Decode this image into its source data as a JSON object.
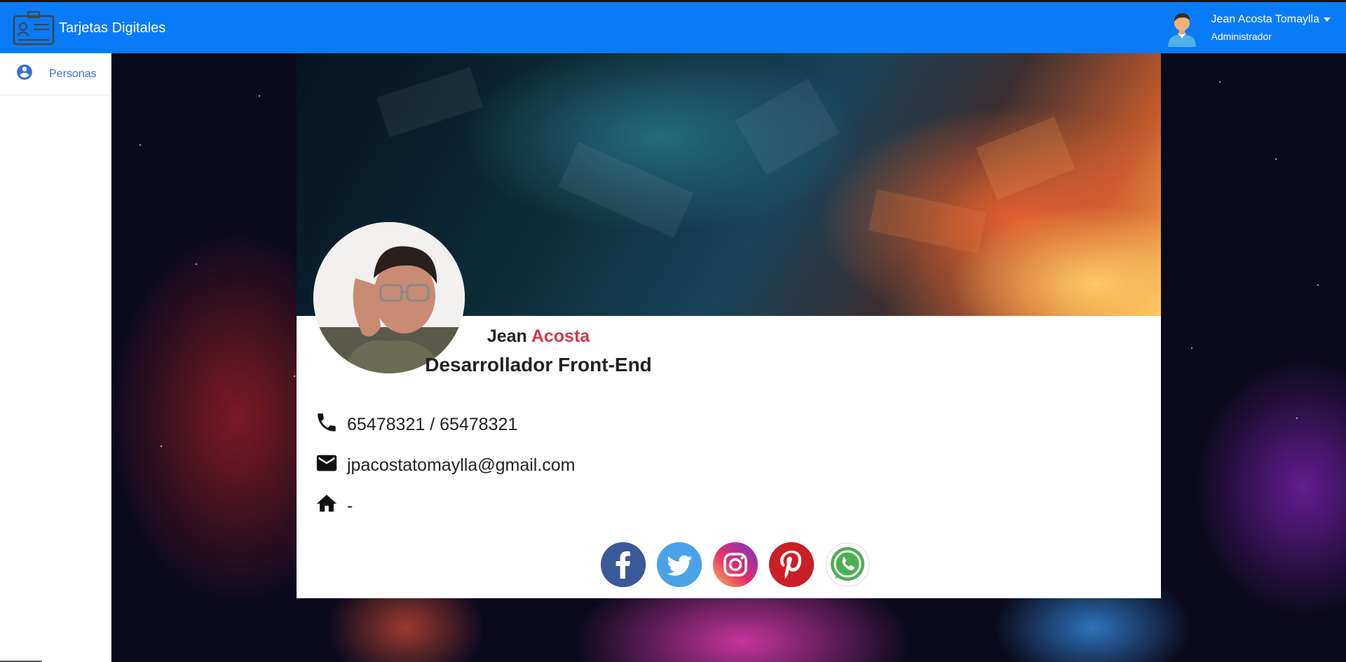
{
  "app": {
    "title": "Tarjetas Digitales",
    "accent_color": "#0a7bf7",
    "logo_icon": "id-card-icon"
  },
  "user": {
    "name": "Jean Acosta Tomaylla",
    "role": "Administrador",
    "avatar_icon": "user-avatar-icon"
  },
  "sidebar": {
    "items": [
      {
        "label": "Personas",
        "icon": "account-circle-icon"
      }
    ]
  },
  "card": {
    "first_name": "Jean",
    "last_name": "Acosta",
    "last_name_color": "#d9364a",
    "title": "Desarrollador Front-End",
    "phone": "65478321 / 65478321",
    "email": "jpacostatomaylla@gmail.com",
    "address": "-",
    "contacts_icons": [
      "phone-icon",
      "email-icon",
      "home-icon"
    ],
    "socials": [
      {
        "name": "facebook",
        "icon": "facebook-icon",
        "color": "#3b5998"
      },
      {
        "name": "twitter",
        "icon": "twitter-icon",
        "color": "#4aa3e8"
      },
      {
        "name": "instagram",
        "icon": "instagram-icon",
        "color": "#c32aa3"
      },
      {
        "name": "pinterest",
        "icon": "pinterest-icon",
        "color": "#cb1f27"
      },
      {
        "name": "whatsapp",
        "icon": "whatsapp-icon",
        "color": "#4caf50"
      }
    ]
  }
}
